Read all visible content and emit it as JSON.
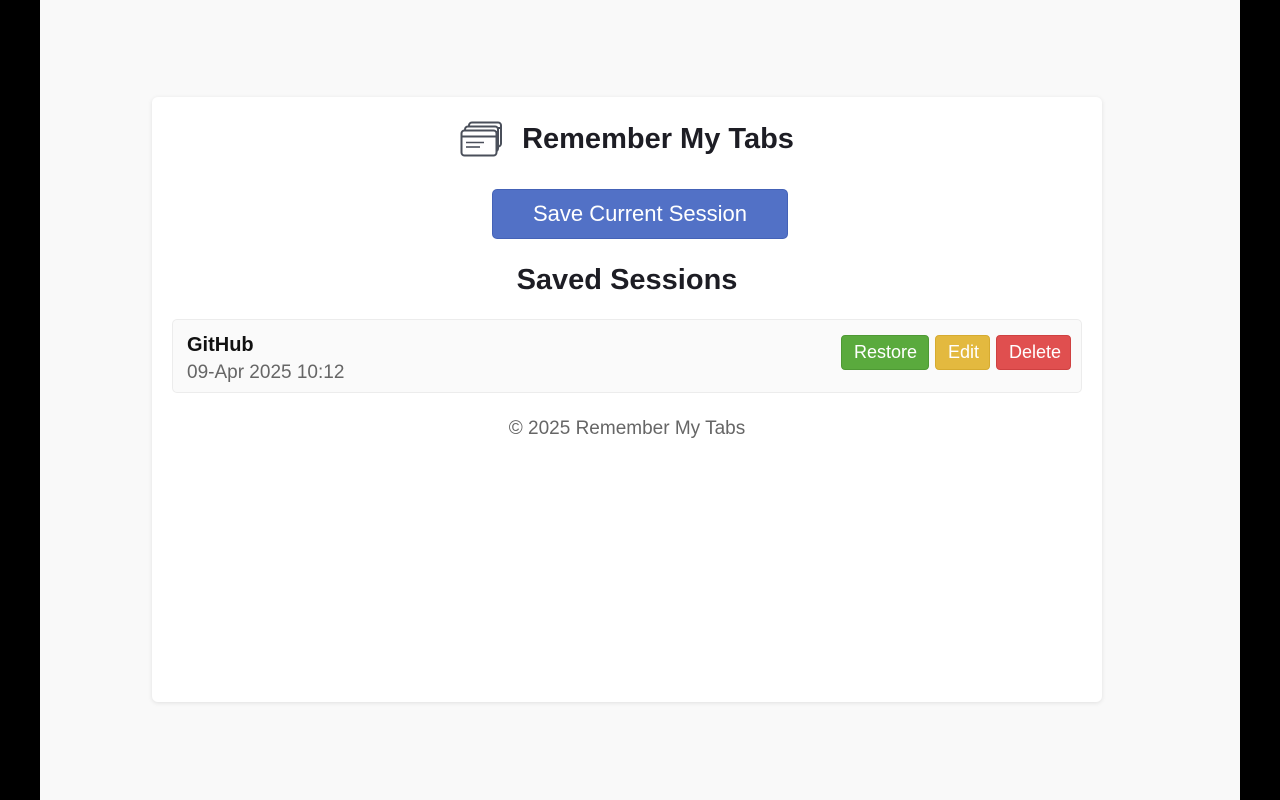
{
  "app": {
    "title": "Remember My Tabs",
    "icon": "stacked-windows-icon"
  },
  "actions": {
    "save_label": "Save Current Session"
  },
  "sessions_section": {
    "title": "Saved Sessions",
    "items": [
      {
        "name": "GitHub",
        "date": "09-Apr 2025 10:12",
        "restore_label": "Restore",
        "edit_label": "Edit",
        "delete_label": "Delete"
      }
    ]
  },
  "footer": {
    "text": "© 2025 Remember My Tabs"
  },
  "colors": {
    "primary": "#5271c6",
    "restore": "#5aaa3d",
    "edit": "#e3b93f",
    "delete": "#e04f4f"
  }
}
